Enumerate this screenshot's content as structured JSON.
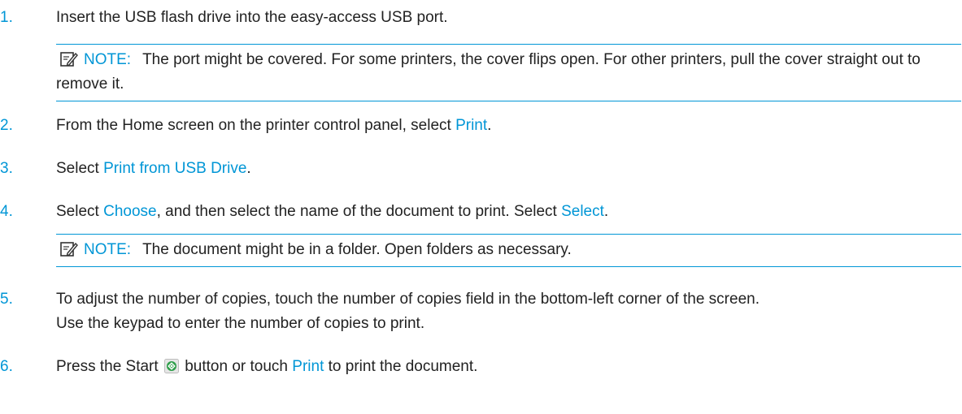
{
  "steps": [
    {
      "number": "1.",
      "text": "Insert the USB flash drive into the easy-access USB port."
    },
    {
      "number": "2.",
      "before": "From the Home screen on the printer control panel, select ",
      "link": "Print",
      "after": "."
    },
    {
      "number": "3.",
      "before": "Select ",
      "link": "Print from USB Drive",
      "after": "."
    },
    {
      "number": "4.",
      "before": "Select ",
      "link": "Choose",
      "middle": ", and then select the name of the document to print. Select ",
      "link2": "Select",
      "after": "."
    },
    {
      "number": "5.",
      "line1": "To adjust the number of copies, touch the number of copies field in the bottom-left corner of the screen.",
      "line2": "Use the keypad to enter the number of copies to print."
    },
    {
      "number": "6.",
      "before": "Press the Start ",
      "middle": " button or touch ",
      "link": "Print",
      "after": " to print the document."
    }
  ],
  "notes": [
    {
      "label": "NOTE:",
      "text": "The port might be covered. For some printers, the cover flips open. For other printers, pull the cover straight out to remove it."
    },
    {
      "label": "NOTE:",
      "text": "The document might be in a folder. Open folders as necessary."
    }
  ],
  "icons": {
    "note": "note-pencil-icon",
    "start": "start-button-icon"
  },
  "colors": {
    "accent": "#0096d6",
    "text": "#222222",
    "start_button": "#2e9e4a"
  }
}
